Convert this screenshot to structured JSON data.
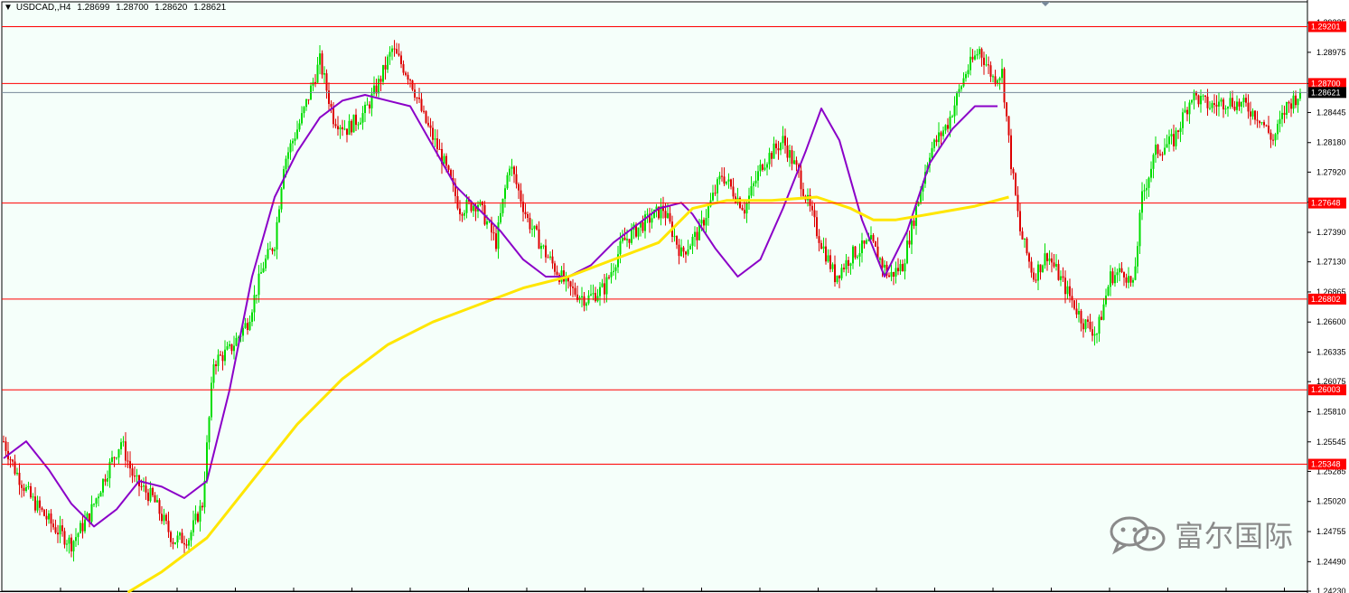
{
  "header": {
    "symbol": "USDCAD,,H4",
    "open": "1.28699",
    "high": "1.28700",
    "low": "1.28620",
    "close": "1.28621"
  },
  "watermark": {
    "text": "富尔国际",
    "icon": "wechat-logo-icon"
  },
  "colors": {
    "background": "#f5fffa",
    "bull": "#00dd00",
    "bear": "#dd0000",
    "ma_fast": "#8b00c8",
    "ma_slow": "#ffe600",
    "level": "#ff0000",
    "price_line": "#778899"
  },
  "chart_data": {
    "type": "candlestick",
    "symbol": "USDCAD",
    "timeframe": "H4",
    "ylim": [
      1.2423,
      1.2934
    ],
    "grid": false,
    "y_ticks": [
      "1.29235",
      "1.28975",
      "1.28700",
      "1.28445",
      "1.28180",
      "1.27920",
      "1.27655",
      "1.27390",
      "1.27130",
      "1.26865",
      "1.26600",
      "1.26335",
      "1.26075",
      "1.25810",
      "1.25545",
      "1.25285",
      "1.25020",
      "1.24755",
      "1.24490",
      "1.24230"
    ],
    "horizontal_levels": [
      "1.29201",
      "1.28700",
      "1.27648",
      "1.26802",
      "1.26003",
      "1.25348"
    ],
    "current_price": "1.28621",
    "price_path": [
      [
        0,
        1.2555
      ],
      [
        5,
        1.253
      ],
      [
        12,
        1.2505
      ],
      [
        22,
        1.248
      ],
      [
        30,
        1.2465
      ],
      [
        38,
        1.249
      ],
      [
        45,
        1.2525
      ],
      [
        52,
        1.2555
      ],
      [
        58,
        1.252
      ],
      [
        66,
        1.2505
      ],
      [
        75,
        1.2468
      ],
      [
        82,
        1.247
      ],
      [
        88,
        1.25
      ],
      [
        93,
        1.2625
      ],
      [
        100,
        1.2635
      ],
      [
        108,
        1.266
      ],
      [
        115,
        1.271
      ],
      [
        120,
        1.273
      ],
      [
        124,
        1.28
      ],
      [
        132,
        1.284
      ],
      [
        140,
        1.289
      ],
      [
        146,
        1.284
      ],
      [
        152,
        1.283
      ],
      [
        160,
        1.2845
      ],
      [
        166,
        1.287
      ],
      [
        172,
        1.29
      ],
      [
        180,
        1.2875
      ],
      [
        186,
        1.284
      ],
      [
        194,
        1.2805
      ],
      [
        202,
        1.276
      ],
      [
        210,
        1.2765
      ],
      [
        218,
        1.273
      ],
      [
        224,
        1.28
      ],
      [
        232,
        1.275
      ],
      [
        240,
        1.272
      ],
      [
        250,
        1.269
      ],
      [
        258,
        1.268
      ],
      [
        266,
        1.269
      ],
      [
        274,
        1.273
      ],
      [
        282,
        1.2745
      ],
      [
        292,
        1.276
      ],
      [
        300,
        1.272
      ],
      [
        308,
        1.274
      ],
      [
        318,
        1.279
      ],
      [
        328,
        1.276
      ],
      [
        336,
        1.28
      ],
      [
        345,
        1.282
      ],
      [
        352,
        1.279
      ],
      [
        360,
        1.274
      ],
      [
        368,
        1.27
      ],
      [
        376,
        1.272
      ],
      [
        384,
        1.273
      ],
      [
        392,
        1.27
      ],
      [
        398,
        1.271
      ],
      [
        404,
        1.276
      ],
      [
        410,
        1.281
      ],
      [
        418,
        1.2835
      ],
      [
        426,
        1.288
      ],
      [
        432,
        1.29
      ],
      [
        438,
        1.2875
      ],
      [
        442,
        1.288
      ],
      [
        446,
        1.28
      ],
      [
        450,
        1.274
      ],
      [
        456,
        1.27
      ],
      [
        462,
        1.272
      ],
      [
        470,
        1.269
      ],
      [
        478,
        1.266
      ],
      [
        484,
        1.265
      ],
      [
        490,
        1.27
      ],
      [
        496,
        1.2705
      ],
      [
        500,
        1.269
      ],
      [
        504,
        1.277
      ],
      [
        510,
        1.281
      ],
      [
        518,
        1.282
      ],
      [
        526,
        1.286
      ],
      [
        534,
        1.285
      ],
      [
        542,
        1.2855
      ],
      [
        550,
        1.285
      ],
      [
        556,
        1.284
      ],
      [
        562,
        1.282
      ],
      [
        568,
        1.285
      ],
      [
        574,
        1.2862
      ]
    ],
    "series": [
      {
        "name": "",
        "type": "ma",
        "color": "#8b00c8",
        "points": [
          [
            0,
            1.254
          ],
          [
            10,
            1.2555
          ],
          [
            20,
            1.253
          ],
          [
            30,
            1.25
          ],
          [
            40,
            1.248
          ],
          [
            50,
            1.2495
          ],
          [
            60,
            1.252
          ],
          [
            70,
            1.2515
          ],
          [
            80,
            1.2505
          ],
          [
            90,
            1.252
          ],
          [
            100,
            1.26
          ],
          [
            110,
            1.27
          ],
          [
            120,
            1.277
          ],
          [
            130,
            1.281
          ],
          [
            140,
            1.284
          ],
          [
            150,
            1.2855
          ],
          [
            160,
            1.286
          ],
          [
            170,
            1.2855
          ],
          [
            180,
            1.285
          ],
          [
            190,
            1.2815
          ],
          [
            200,
            1.278
          ],
          [
            210,
            1.276
          ],
          [
            220,
            1.274
          ],
          [
            230,
            1.2715
          ],
          [
            240,
            1.27
          ],
          [
            250,
            1.27
          ],
          [
            260,
            1.271
          ],
          [
            270,
            1.273
          ],
          [
            280,
            1.2745
          ],
          [
            290,
            1.276
          ],
          [
            300,
            1.2765
          ],
          [
            305,
            1.2755
          ],
          [
            315,
            1.2725
          ],
          [
            325,
            1.27
          ],
          [
            335,
            1.2715
          ],
          [
            345,
            1.276
          ],
          [
            355,
            1.281
          ],
          [
            362,
            1.2848
          ],
          [
            370,
            1.282
          ],
          [
            380,
            1.275
          ],
          [
            390,
            1.27
          ],
          [
            400,
            1.274
          ],
          [
            410,
            1.28
          ],
          [
            420,
            1.283
          ],
          [
            430,
            1.285
          ],
          [
            440,
            1.285
          ]
        ]
      },
      {
        "name": "",
        "type": "ma",
        "color": "#ffe600",
        "points": [
          [
            55,
            1.2422
          ],
          [
            70,
            1.244
          ],
          [
            90,
            1.247
          ],
          [
            110,
            1.252
          ],
          [
            130,
            1.257
          ],
          [
            150,
            1.261
          ],
          [
            170,
            1.264
          ],
          [
            190,
            1.266
          ],
          [
            210,
            1.2675
          ],
          [
            230,
            1.269
          ],
          [
            250,
            1.27
          ],
          [
            270,
            1.2715
          ],
          [
            290,
            1.273
          ],
          [
            305,
            1.276
          ],
          [
            320,
            1.2767
          ],
          [
            340,
            1.2767
          ],
          [
            360,
            1.277
          ],
          [
            375,
            1.276
          ],
          [
            385,
            1.275
          ],
          [
            395,
            1.275
          ],
          [
            410,
            1.2755
          ],
          [
            430,
            1.2762
          ],
          [
            445,
            1.277
          ]
        ]
      }
    ]
  }
}
